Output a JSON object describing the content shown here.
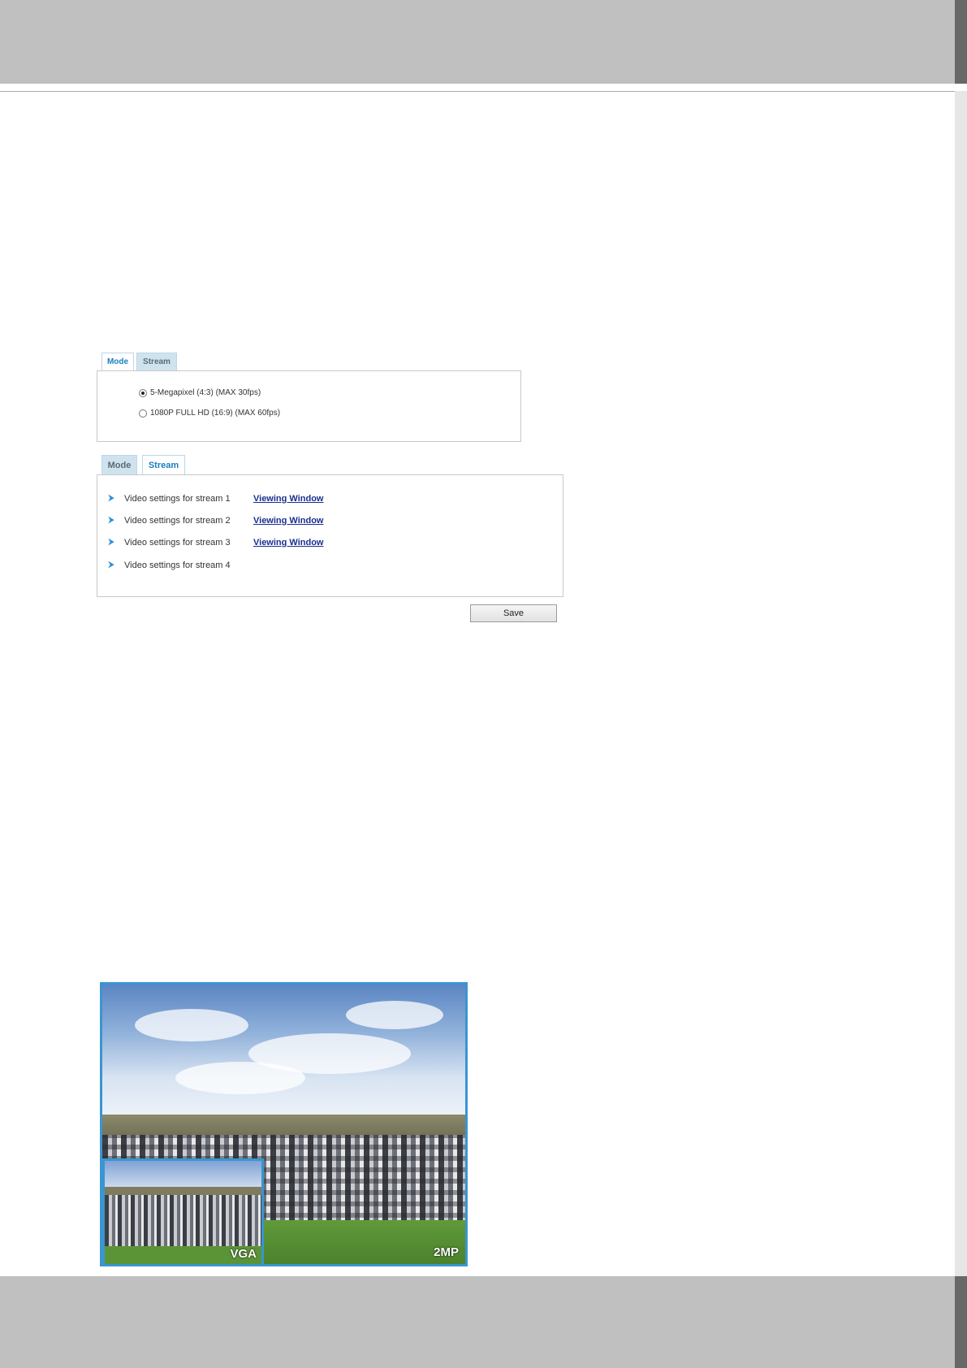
{
  "mode_panel": {
    "tabs": [
      {
        "label": "Mode",
        "active": true
      },
      {
        "label": "Stream",
        "active": false
      }
    ],
    "options": [
      {
        "label": "5-Megapixel (4:3) (MAX 30fps)",
        "checked": true
      },
      {
        "label": "1080P FULL HD (16:9) (MAX 60fps)",
        "checked": false
      }
    ]
  },
  "stream_panel": {
    "tabs": [
      {
        "label": "Mode",
        "active": false
      },
      {
        "label": "Stream",
        "active": true
      }
    ],
    "rows": [
      {
        "label": "Video settings for stream 1",
        "link": "Viewing Window"
      },
      {
        "label": "Video settings for stream 2",
        "link": "Viewing Window"
      },
      {
        "label": "Video settings for stream 3",
        "link": "Viewing Window"
      },
      {
        "label": "Video settings for stream 4",
        "link": ""
      }
    ],
    "save_label": "Save"
  },
  "photo": {
    "inset_label": "VGA",
    "main_label": "2MP"
  },
  "colors": {
    "accent": "#1a7fc1",
    "link": "#1a2f8f",
    "frame": "#3a95d1"
  }
}
